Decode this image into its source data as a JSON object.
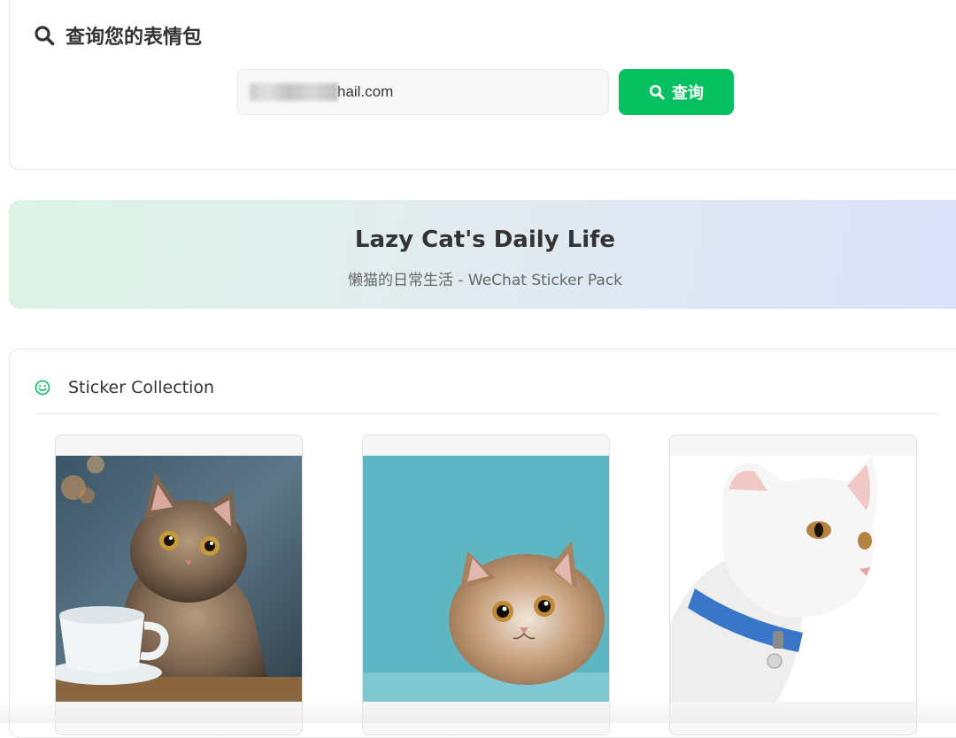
{
  "query": {
    "title": "查询您的表情包",
    "email_value": "hail.com",
    "button_label": "查询"
  },
  "banner": {
    "title": "Lazy Cat's Daily Life",
    "subtitle": "懒猫的日常生活 - WeChat Sticker Pack"
  },
  "collection": {
    "title": "Sticker Collection",
    "stickers": [
      {
        "icon": "tabby-cat-with-coffee-cup-image"
      },
      {
        "icon": "fluffy-cat-teal-background-image"
      },
      {
        "icon": "white-cat-blue-collar-image"
      }
    ]
  },
  "colors": {
    "accent": "#07c160",
    "banner_start": "#dcf3e6",
    "banner_end": "#dbe2fb",
    "text": "#333333",
    "subtext": "#666666"
  }
}
